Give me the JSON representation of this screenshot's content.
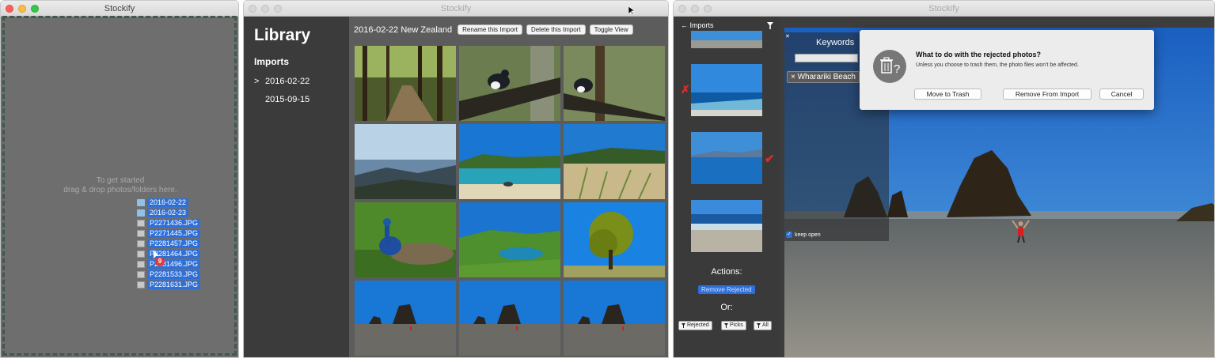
{
  "window1": {
    "title": "Stockify",
    "hint_line1": "To get started",
    "hint_line2": "drag & drop photos/folders here.",
    "drag_items": [
      {
        "type": "folder",
        "label": "2016-02-22"
      },
      {
        "type": "folder",
        "label": "2016-02-23"
      },
      {
        "type": "file",
        "label": "P2271436.JPG"
      },
      {
        "type": "file",
        "label": "P2271445.JPG"
      },
      {
        "type": "file",
        "label": "P2281457.JPG"
      },
      {
        "type": "file",
        "label": "P2281464.JPG"
      },
      {
        "type": "file",
        "label": "P2281496.JPG"
      },
      {
        "type": "file",
        "label": "P2281533.JPG"
      },
      {
        "type": "file",
        "label": "P2281631.JPG"
      }
    ],
    "drag_count": "9"
  },
  "window2": {
    "title": "Stockify",
    "sidebar": {
      "library": "Library",
      "imports_heading": "Imports",
      "imports": [
        {
          "marker": ">",
          "label": "2016-02-22"
        },
        {
          "marker": "",
          "label": "2015-09-15"
        }
      ]
    },
    "header": {
      "title": "2016-02-22 New Zealand",
      "rename": "Rename this Import",
      "delete": "Delete this Import",
      "toggle": "Toggle View"
    },
    "photos": [
      "forest-trail",
      "bird-on-branch",
      "bird-on-branch-2",
      "lake-vista",
      "lagoon-beach",
      "dune-grass",
      "peacock",
      "green-hills-lake",
      "round-tree",
      "rock-beach-1",
      "rock-beach-2",
      "rock-beach-3"
    ]
  },
  "window3": {
    "title": "Stockify",
    "nav_back": "← Imports",
    "actions_label": "Actions:",
    "remove_rejected": "Remove Rejected",
    "or_label": "Or:",
    "filters": [
      "Rejected",
      "Picks",
      "All"
    ],
    "keywords": {
      "title": "Keywords",
      "tag": "× Wharariki Beach",
      "keep_open": "keep open"
    },
    "dialog": {
      "title": "What to do with the rejected photos?",
      "text": "Unless you choose to trash them, the photo files won't be affected.",
      "move_trash": "Move to Trash",
      "remove_import": "Remove From Import",
      "cancel": "Cancel"
    }
  }
}
